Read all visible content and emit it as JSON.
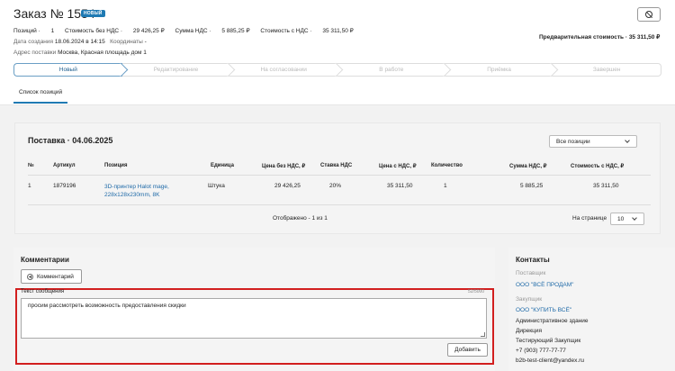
{
  "header": {
    "title": "Заказ № 1554",
    "badge": "НОВЫЙ",
    "positions_label": "Позиций",
    "positions_value": "1",
    "cost_no_vat_label": "Стоимость без НДС",
    "cost_no_vat_value": "29 426,25 ₽",
    "vat_sum_label": "Сумма НДС",
    "vat_sum_value": "5 885,25 ₽",
    "cost_vat_label": "Стоимость с НДС",
    "cost_vat_value": "35 311,50 ₽",
    "created_label": "Дата создания",
    "created_value": "18.06.2024 в 14:15",
    "coords_label": "Координаты",
    "coords_value": "-",
    "address_label": "Адрес поставки",
    "address_value": "Москва, Красная площадь дом 1",
    "prelim_label": "Предварительная стоимость",
    "prelim_value": "35 311,50 ₽"
  },
  "stepper": [
    "Новый",
    "Редактирование",
    "На согласовании",
    "В работе",
    "Приёмка",
    "Завершен"
  ],
  "tabs": {
    "positions": "Список позиций"
  },
  "positions": {
    "title": "Поставка · 04.06.2025",
    "filter": "Все позиции",
    "columns": [
      "№",
      "Артикул",
      "Позиция",
      "Единица",
      "Цена без НДС, ₽",
      "Ставка НДС",
      "Цена с НДС, ₽",
      "Количество",
      "Сумма НДС, ₽",
      "Стоимость с НДС, ₽"
    ],
    "row": {
      "num": "1",
      "sku": "1879196",
      "name_line1": "3D-принтер Halot mage,",
      "name_line2": "228x128x230mm, 8K",
      "unit": "Штука",
      "price_no_vat": "29 426,25",
      "vat_rate": "20%",
      "price_vat": "35 311,50",
      "qty": "1",
      "vat_sum": "5 885,25",
      "total": "35 311,50"
    },
    "shown": "Отображено - 1 из 1",
    "per_page_label": "На странице",
    "per_page_value": "10"
  },
  "comments": {
    "title": "Комментарии",
    "add_comment": "Комментарий",
    "message_label": "Текст сообщения",
    "counter": "52/5000",
    "message_text": "просим рассмотреть возможность предоставления скидки",
    "add_button": "Добавить"
  },
  "contacts": {
    "title": "Контакты",
    "supplier_label": "Поставщик",
    "supplier_name": "ООО \"ВСЁ ПРОДАМ\"",
    "buyer_label": "Закупщик",
    "buyer_name": "ООО \"КУПИТЬ ВСЁ\"",
    "building": "Административное здание",
    "department": "Дирекция",
    "person": "Тестирующий Закупщик",
    "phone": "+7 (903) 777-77-77",
    "email": "b2b-test-client@yandex.ru"
  }
}
